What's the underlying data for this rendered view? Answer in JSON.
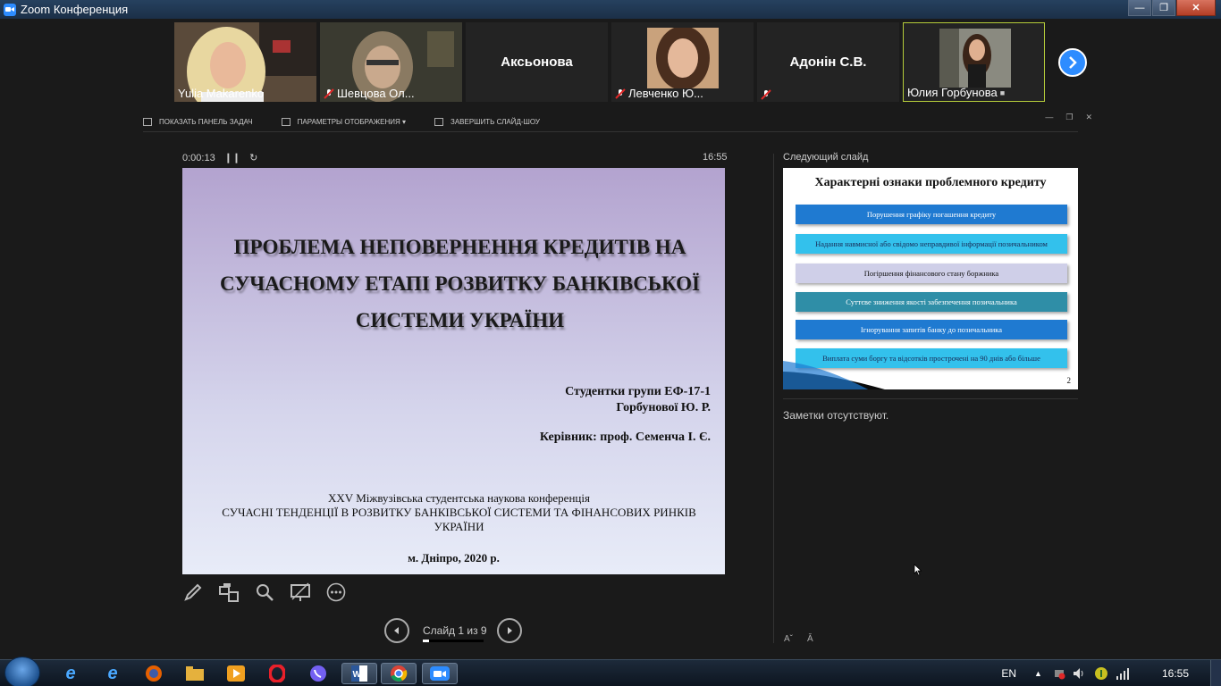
{
  "window": {
    "title": "Zoom Конференция",
    "buttons": [
      "minimize",
      "maximize",
      "close"
    ]
  },
  "participants": [
    {
      "name": "Yulia Makarenko",
      "video": true,
      "muted": false,
      "active": false
    },
    {
      "name": "Шевцова Ол...",
      "video": true,
      "muted": true,
      "active": false
    },
    {
      "name": "Аксьонова",
      "video": false,
      "muted": false,
      "active": false
    },
    {
      "name": "Левченко Ю...",
      "video": true,
      "muted": true,
      "active": false
    },
    {
      "name": "Адонін С.В.",
      "video": false,
      "muted": true,
      "active": false
    },
    {
      "name": "Юлия Горбунова",
      "video": true,
      "muted": false,
      "active": true
    }
  ],
  "presenter_toolbar": {
    "show_taskbar": "ПОКАЗАТЬ ПАНЕЛЬ ЗАДАЧ",
    "display_settings": "ПАРАМЕТРЫ ОТОБРАЖЕНИЯ ▾",
    "end_slideshow": "ЗАВЕРШИТЬ СЛАЙД-ШОУ"
  },
  "timer": {
    "elapsed": "0:00:13",
    "clock": "16:55"
  },
  "current_slide": {
    "title": "ПРОБЛЕМА НЕПОВЕРНЕННЯ КРЕДИТІВ НА СУЧАСНОМУ ЕТАПІ РОЗВИТКУ БАНКІВСЬКОЇ СИСТЕМИ УКРАЇНИ",
    "author_line1": "Студентки групи ЕФ-17-1",
    "author_line2": "Горбунової Ю. Р.",
    "supervisor": "Керівник: проф. Семенча І. Є.",
    "conference_line1": "XXV Міжвузівська студентська наукова конференція",
    "conference_line2": "СУЧАСНІ ТЕНДЕНЦІЇ В РОЗВИТКУ БАНКІВСЬКОЇ СИСТЕМИ ТА ФІНАНСОВИХ РИНКІВ УКРАЇНИ",
    "city": "м. Дніпро, 2020 р."
  },
  "navigation": {
    "label": "Слайд 1 из 9",
    "progress": 0.11
  },
  "next_slide": {
    "header": "Следующий слайд",
    "title": "Характерні ознаки проблемного кредиту",
    "items": [
      {
        "text": "Порушення графіку погашення кредиту",
        "bg": "#1f7ad1",
        "fg": "#ffffff"
      },
      {
        "text": "Надання навмисної або свідомо неправдивої інформації позичальником",
        "bg": "#33c1ec",
        "fg": "#1a2a55"
      },
      {
        "text": "Погіршення фінансового стану боржника",
        "bg": "#cfcfe8",
        "fg": "#111111"
      },
      {
        "text": "Суттєве зниження якості забезпечення позичальника",
        "bg": "#2f8ea7",
        "fg": "#ffffff"
      },
      {
        "text": "Ігнорування запитів банку до позичальника",
        "bg": "#1f7ad1",
        "fg": "#ffffff"
      },
      {
        "text": "Виплата суми боргу та відсотків прострочені на 90 днів або більше",
        "bg": "#33c1ec",
        "fg": "#1a2a55"
      }
    ],
    "page": "2"
  },
  "notes": "Заметки отсутствуют.",
  "taskbar": {
    "lang": "EN",
    "time": "16:55"
  },
  "colors": {
    "accent": "#2d8cff",
    "active_border": "#b5cc3a"
  }
}
